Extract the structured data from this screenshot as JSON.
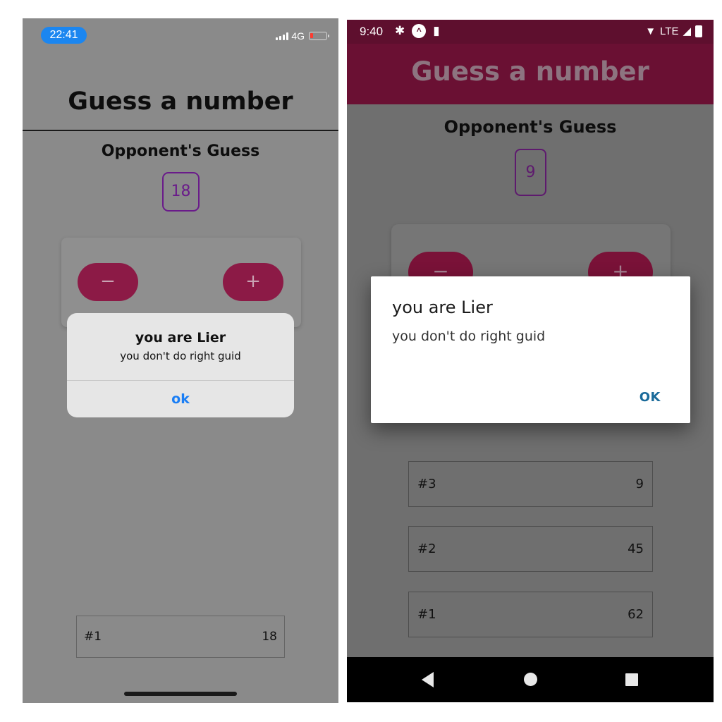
{
  "ios": {
    "status": {
      "time": "22:41",
      "network": "4G"
    },
    "title": "Guess a number",
    "opponent_label": "Opponent's Guess",
    "guess": "18",
    "buttons": {
      "minus": "−",
      "plus": "+"
    },
    "alert": {
      "title": "you are Lier",
      "message": "you don't do right guid",
      "ok": "ok"
    },
    "rounds": [
      {
        "label": "#1",
        "value": "18"
      }
    ]
  },
  "android": {
    "status": {
      "time": "9:40",
      "network": "LTE"
    },
    "title": "Guess a number",
    "opponent_label": "Opponent's Guess",
    "guess": "9",
    "buttons": {
      "minus": "−",
      "plus": "+"
    },
    "dialog": {
      "title": "you are Lier",
      "message": "you don't do right guid",
      "ok": "OK"
    },
    "rounds": [
      {
        "label": "#3",
        "value": "9"
      },
      {
        "label": "#2",
        "value": "45"
      },
      {
        "label": "#1",
        "value": "62"
      }
    ]
  },
  "colors": {
    "accent": "#8c1a46",
    "guess_border": "#6a1b8a",
    "ios_link": "#1a7ef5",
    "android_link": "#1a6a9a",
    "android_appbar": "#6a1033"
  }
}
